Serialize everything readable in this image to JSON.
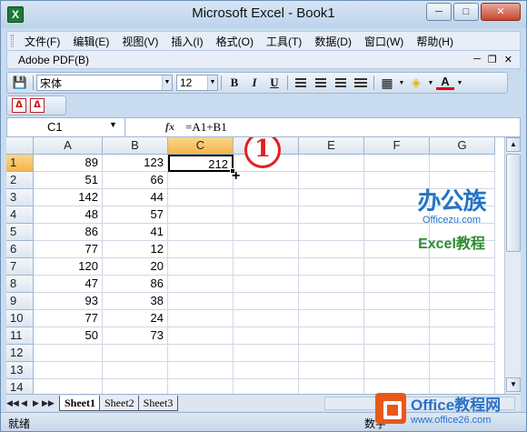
{
  "window": {
    "title": "Microsoft Excel - Book1",
    "icon_letter": "X"
  },
  "menubar": {
    "items": [
      "文件(F)",
      "编辑(E)",
      "视图(V)",
      "插入(I)",
      "格式(O)",
      "工具(T)",
      "数据(D)",
      "窗口(W)",
      "帮助(H)"
    ],
    "adobe_label": "Adobe PDF(B)"
  },
  "toolbar": {
    "font_name": "宋体",
    "font_size": "12",
    "bold_label": "B",
    "italic_label": "I",
    "underline_label": "U"
  },
  "formula_bar": {
    "name_box": "C1",
    "fx_label": "fx",
    "formula": "=A1+B1"
  },
  "sheet": {
    "columns": [
      "A",
      "B",
      "C",
      "D",
      "E",
      "F",
      "G"
    ],
    "active_column": "C",
    "rows": [
      {
        "num": "1",
        "a": "89",
        "b": "123",
        "c": "212"
      },
      {
        "num": "2",
        "a": "51",
        "b": "66",
        "c": ""
      },
      {
        "num": "3",
        "a": "142",
        "b": "44",
        "c": ""
      },
      {
        "num": "4",
        "a": "48",
        "b": "57",
        "c": ""
      },
      {
        "num": "5",
        "a": "86",
        "b": "41",
        "c": ""
      },
      {
        "num": "6",
        "a": "77",
        "b": "12",
        "c": ""
      },
      {
        "num": "7",
        "a": "120",
        "b": "20",
        "c": ""
      },
      {
        "num": "8",
        "a": "47",
        "b": "86",
        "c": ""
      },
      {
        "num": "9",
        "a": "93",
        "b": "38",
        "c": ""
      },
      {
        "num": "10",
        "a": "77",
        "b": "24",
        "c": ""
      },
      {
        "num": "11",
        "a": "50",
        "b": "73",
        "c": ""
      },
      {
        "num": "12",
        "a": "",
        "b": "",
        "c": ""
      },
      {
        "num": "13",
        "a": "",
        "b": "",
        "c": ""
      },
      {
        "num": "14",
        "a": "",
        "b": "",
        "c": ""
      }
    ],
    "callout": "1"
  },
  "tabs": [
    "Sheet1",
    "Sheet2",
    "Sheet3"
  ],
  "status": {
    "left": "就绪",
    "right": "数字"
  },
  "watermark1": {
    "name": "办公族",
    "url": "Officezu.com",
    "sub": "Excel教程"
  },
  "watermark2": {
    "title": "Office教程网",
    "url": "www.office26.com"
  },
  "colors": {
    "accent": "#2574c4",
    "callout": "#e02020",
    "selected_header": "#f4b54b"
  }
}
